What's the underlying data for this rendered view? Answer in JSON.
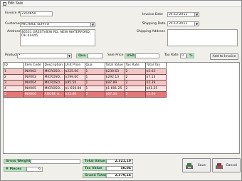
{
  "window": {
    "title": "Edit Sale"
  },
  "invoice": {
    "label": "Invoice #",
    "value": "2350650"
  },
  "customer": {
    "label": "Customer",
    "value": "MICHAEL SEPH.O"
  },
  "address": {
    "label": "Address",
    "value": "46531 GRESTVIEW RD, NEW WATERFORD, OH 44445"
  },
  "invoice_date": {
    "label": "Invoice Date",
    "value": "24.12.2011"
  },
  "shipping_date": {
    "label": "Shipping Date",
    "value": "24.12.2011"
  },
  "shipping_address": {
    "label": "Shipping Address",
    "value": ""
  },
  "product_row": {
    "product_label": "Product",
    "product_value": "*",
    "qua_label": "Qua",
    "sale_price_label": "Sale Price",
    "currency": "USD",
    "tax_rate_label": "Tax Rate",
    "tax_unit": "%",
    "tax_value": "0",
    "add_button": "Add to Invoice"
  },
  "table": {
    "columns": [
      "ID",
      "Item Code",
      "Description",
      "Unit Price",
      "Qua",
      "Total Value",
      "Tax Rate",
      "Total Tax"
    ],
    "rows": [
      [
        "1",
        "INV002",
        "MICROSO...",
        "$225.00",
        "1",
        "$230.63",
        "2",
        "$5.63"
      ],
      [
        "2",
        "INV003",
        "MICROSO...",
        "$299.00",
        "1",
        "$292.13",
        "2",
        "$7.13"
      ],
      [
        "3",
        "INV004",
        "MICROSO...",
        "$95.50",
        "1",
        "$97.89",
        "2",
        "$2.39"
      ],
      [
        "4",
        "INV005",
        "MICROSO...",
        "$1 650.00",
        "1",
        "$1 691.25",
        "2",
        "$41.25"
      ],
      [
        "5",
        "INV006",
        "ADOBE A...",
        "$32.80",
        "2",
        "$67.24",
        "2",
        "$1.64"
      ]
    ]
  },
  "footer": {
    "gross_weight_label": "Gross Weight",
    "gross_weight_value": "",
    "pieces_label": "# Pieces",
    "pieces_value": "6",
    "total_value_label": "Total Value",
    "total_value": "2,321,10",
    "tax_value_label": "Tax Value",
    "tax_value": "58,04",
    "grand_total_label": "Grand Total",
    "grand_total": "2,379,14",
    "save_button": "Save",
    "cancel_button": "Cancel"
  },
  "icons": {
    "dropdown": "chevron-down-icon",
    "save": "save-icon",
    "cancel": "cancel-icon"
  },
  "colors": {
    "row_odd": "#f3c6c6",
    "row_even": "#fae4e4",
    "row_selected": "#e37777",
    "green_label": "#c2dec7"
  }
}
